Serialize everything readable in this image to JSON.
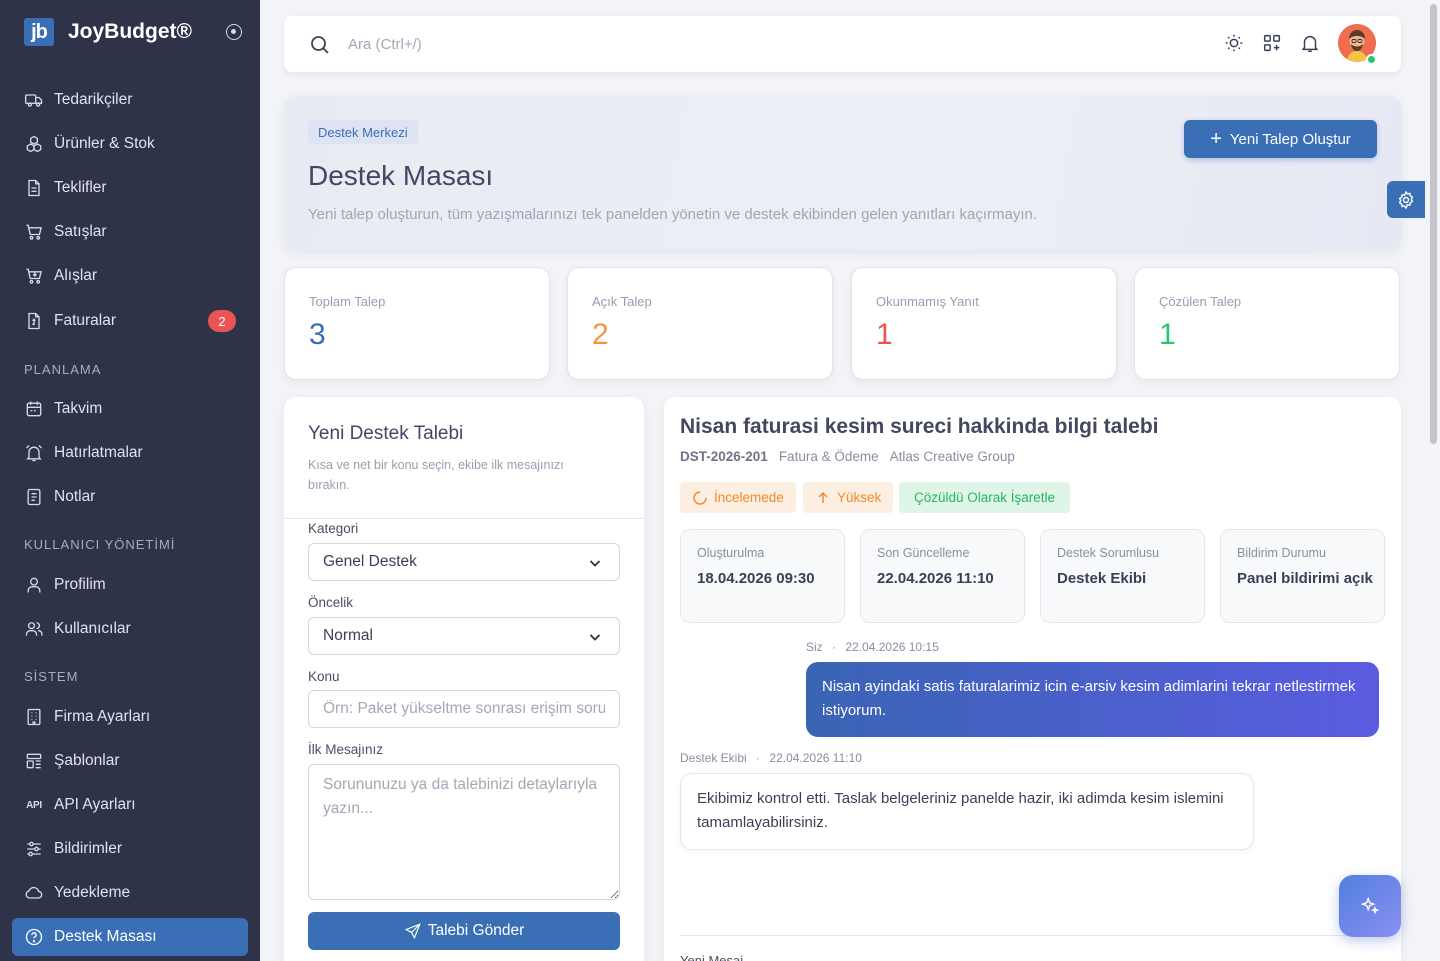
{
  "brand": {
    "logo": "jb",
    "name": "JoyBudget®"
  },
  "sidebar": {
    "items": [
      {
        "label": "Tedarikçiler",
        "icon": "truck-icon"
      },
      {
        "label": "Ürünler & Stok",
        "icon": "boxes-icon"
      },
      {
        "label": "Teklifler",
        "icon": "file-icon"
      },
      {
        "label": "Satışlar",
        "icon": "cart-icon"
      },
      {
        "label": "Alışlar",
        "icon": "cart-down-icon"
      },
      {
        "label": "Faturalar",
        "icon": "invoice-icon",
        "badge": "2"
      },
      {
        "label": "Takvim",
        "icon": "calendar-icon"
      },
      {
        "label": "Hatırlatmalar",
        "icon": "alarm-icon"
      },
      {
        "label": "Notlar",
        "icon": "notes-icon"
      },
      {
        "label": "Profilim",
        "icon": "user-icon"
      },
      {
        "label": "Kullanıcılar",
        "icon": "users-icon"
      },
      {
        "label": "Firma Ayarları",
        "icon": "building-icon"
      },
      {
        "label": "Şablonlar",
        "icon": "template-icon"
      },
      {
        "label": "API Ayarları",
        "icon": "api-icon"
      },
      {
        "label": "Bildirimler",
        "icon": "sliders-icon"
      },
      {
        "label": "Yedekleme",
        "icon": "cloud-icon"
      },
      {
        "label": "Destek Masası",
        "icon": "help-icon",
        "active": true
      }
    ],
    "sections": {
      "planning": "PLANLAMA",
      "users": "KULLANICI YÖNETİMİ",
      "system": "SİSTEM"
    }
  },
  "topbar": {
    "search_placeholder": "Ara (Ctrl+/)"
  },
  "hero": {
    "badge": "Destek Merkezi",
    "title": "Destek Masası",
    "subtitle": "Yeni talep oluşturun, tüm yazışmalarınızı tek panelden yönetin ve destek ekibinden gelen yanıtları kaçırmayın.",
    "button": "Yeni Talep Oluştur"
  },
  "stats": [
    {
      "label": "Toplam Talep",
      "value": "3",
      "color": "#3a6fb5"
    },
    {
      "label": "Açık Talep",
      "value": "2",
      "color": "#f5963b"
    },
    {
      "label": "Okunmamış Yanıt",
      "value": "1",
      "color": "#ea5455"
    },
    {
      "label": "Çözülen Talep",
      "value": "1",
      "color": "#28c76f"
    }
  ],
  "form": {
    "title": "Yeni Destek Talebi",
    "subtitle": "Kısa ve net bir konu seçin, ekibe ilk mesajınızı bırakın.",
    "category_label": "Kategori",
    "category_value": "Genel Destek",
    "priority_label": "Öncelik",
    "priority_value": "Normal",
    "subject_label": "Konu",
    "subject_placeholder": "Örn: Paket yükseltme sonrası erişim sorunu",
    "message_label": "İlk Mesajınız",
    "message_placeholder": "Sorununuzu ya da talebinizi detaylarıyla yazın...",
    "submit": "Talebi Gönder"
  },
  "ticket": {
    "title": "Nisan faturasi kesim sureci hakkinda bilgi talebi",
    "code": "DST-2026-201",
    "category": "Fatura & Ödeme",
    "company": "Atlas Creative Group",
    "status": "İncelemede",
    "priority": "Yüksek",
    "resolve_button": "Çözüldü Olarak İşaretle",
    "info": [
      {
        "label": "Oluşturulma",
        "value": "18.04.2026 09:30"
      },
      {
        "label": "Son Güncelleme",
        "value": "22.04.2026 11:10"
      },
      {
        "label": "Destek Sorumlusu",
        "value": "Destek Ekibi"
      },
      {
        "label": "Bildirim Durumu",
        "value": "Panel bildirimi açık"
      }
    ],
    "messages": [
      {
        "author": "Siz",
        "time": "22.04.2026 10:15",
        "text": "Nisan ayindaki satis faturalarimiz icin e-arsiv kesim adimlarini tekrar netlestirmek istiyorum."
      },
      {
        "author": "Destek Ekibi",
        "time": "22.04.2026 11:10",
        "text": "Ekibimiz kontrol etti. Taslak belgeleriniz panelde hazir, iki adimda kesim islemini tamamlayabilirsiniz."
      }
    ],
    "meta_separator": "·",
    "next_label": "Yeni Mesaj"
  }
}
